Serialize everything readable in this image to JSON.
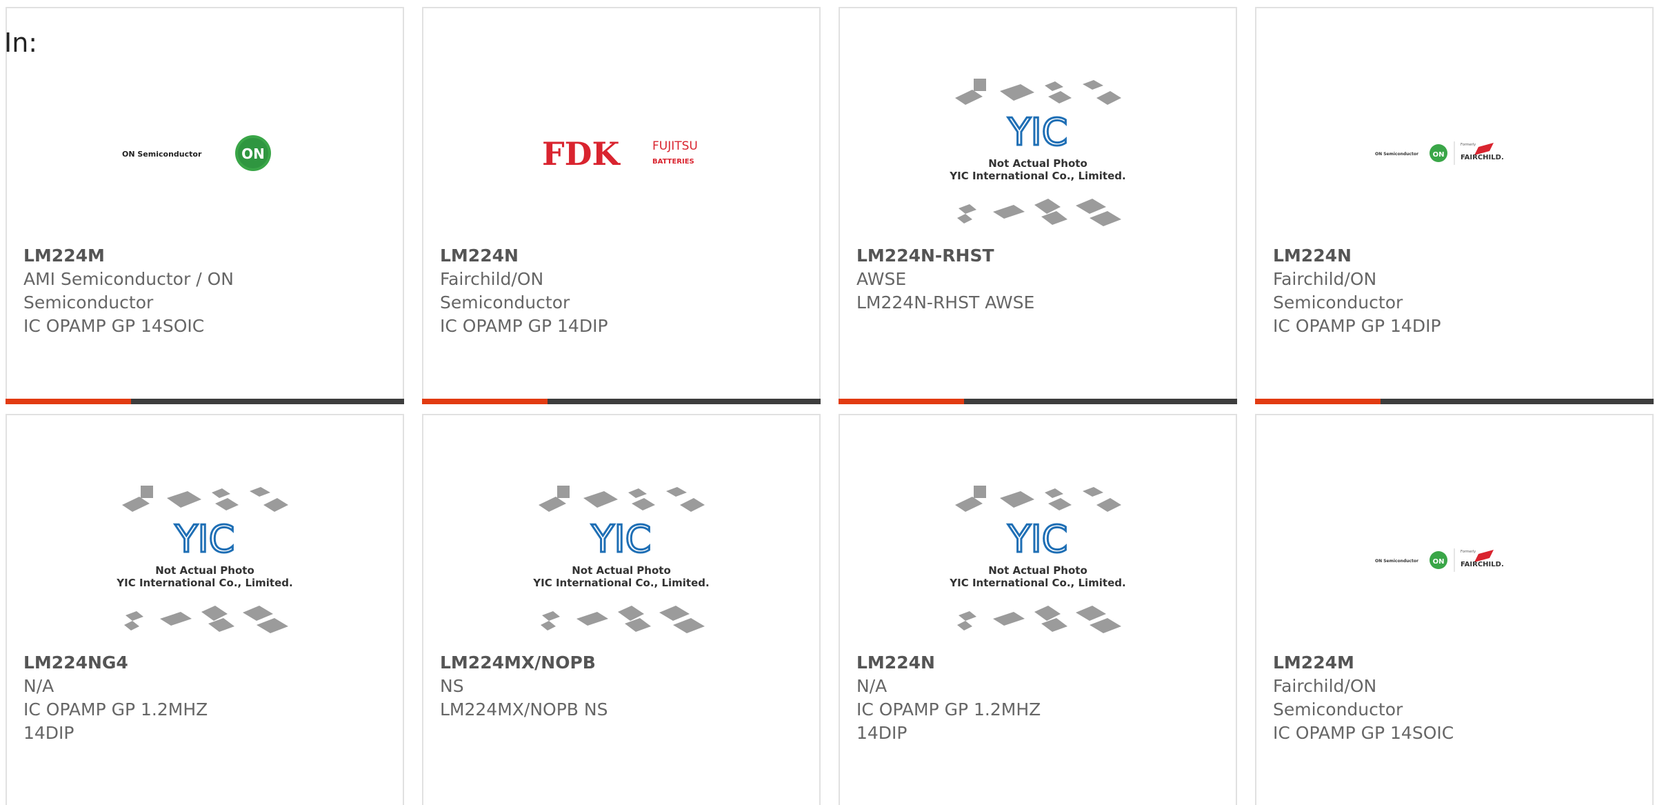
{
  "header": {
    "in_label": "In:"
  },
  "colors": {
    "accent": "#e23b12",
    "bar": "#3d3d3d",
    "border": "#e1e1e1",
    "text": "#666666"
  },
  "logos": {
    "on_semi": {
      "text": "ON Semiconductor",
      "badge": "ON"
    },
    "fdk": {
      "text": "FDK",
      "sub1": "FUJITSU",
      "sub2": "BATTERIES"
    },
    "yic": {
      "mark": "YIC",
      "line1": "Not Actual Photo",
      "line2": "YIC International Co., Limited."
    },
    "fairchild": {
      "on_text": "ON Semiconductor",
      "badge": "ON",
      "formerly": "Formerly",
      "name": "FAIRCHILD."
    }
  },
  "cards": [
    {
      "part": "LM224M",
      "manufacturer": "AMI Semiconductor / ON Semiconductor",
      "description": "IC OPAMP GP 14SOIC",
      "logo": "on_semi"
    },
    {
      "part": "LM224N",
      "manufacturer": "Fairchild/ON Semiconductor",
      "description": "IC OPAMP GP 14DIP",
      "logo": "fdk"
    },
    {
      "part": "LM224N-RHST",
      "manufacturer": "AWSE",
      "description": "LM224N-RHST AWSE",
      "logo": "yic"
    },
    {
      "part": "LM224N",
      "manufacturer": "Fairchild/ON Semiconductor",
      "description": "IC OPAMP GP 14DIP",
      "logo": "fairchild"
    },
    {
      "part": "LM224NG4",
      "manufacturer": "N/A",
      "description": "IC OPAMP GP 1.2MHZ 14DIP",
      "logo": "yic"
    },
    {
      "part": "LM224MX/NOPB",
      "manufacturer": "NS",
      "description": "LM224MX/NOPB NS",
      "logo": "yic"
    },
    {
      "part": "LM224N",
      "manufacturer": "N/A",
      "description": "IC OPAMP GP 1.2MHZ 14DIP",
      "logo": "yic"
    },
    {
      "part": "LM224M",
      "manufacturer": "Fairchild/ON Semiconductor",
      "description": "IC OPAMP GP 14SOIC",
      "logo": "fairchild"
    }
  ]
}
